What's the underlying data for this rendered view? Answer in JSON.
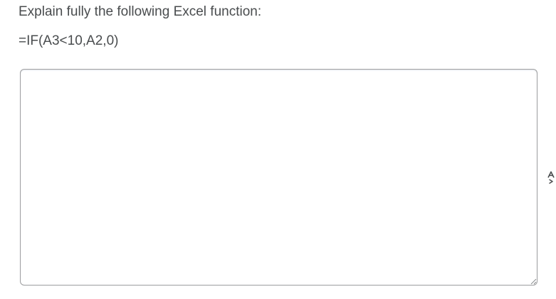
{
  "question": {
    "prompt": "Explain fully the following Excel function:",
    "formula": "=IF(A3<10,A2,0)"
  },
  "answer": {
    "value": "",
    "placeholder": ""
  },
  "icons": {
    "side_tool": "spellcheck-icon",
    "resize": "resize-grip-icon"
  }
}
